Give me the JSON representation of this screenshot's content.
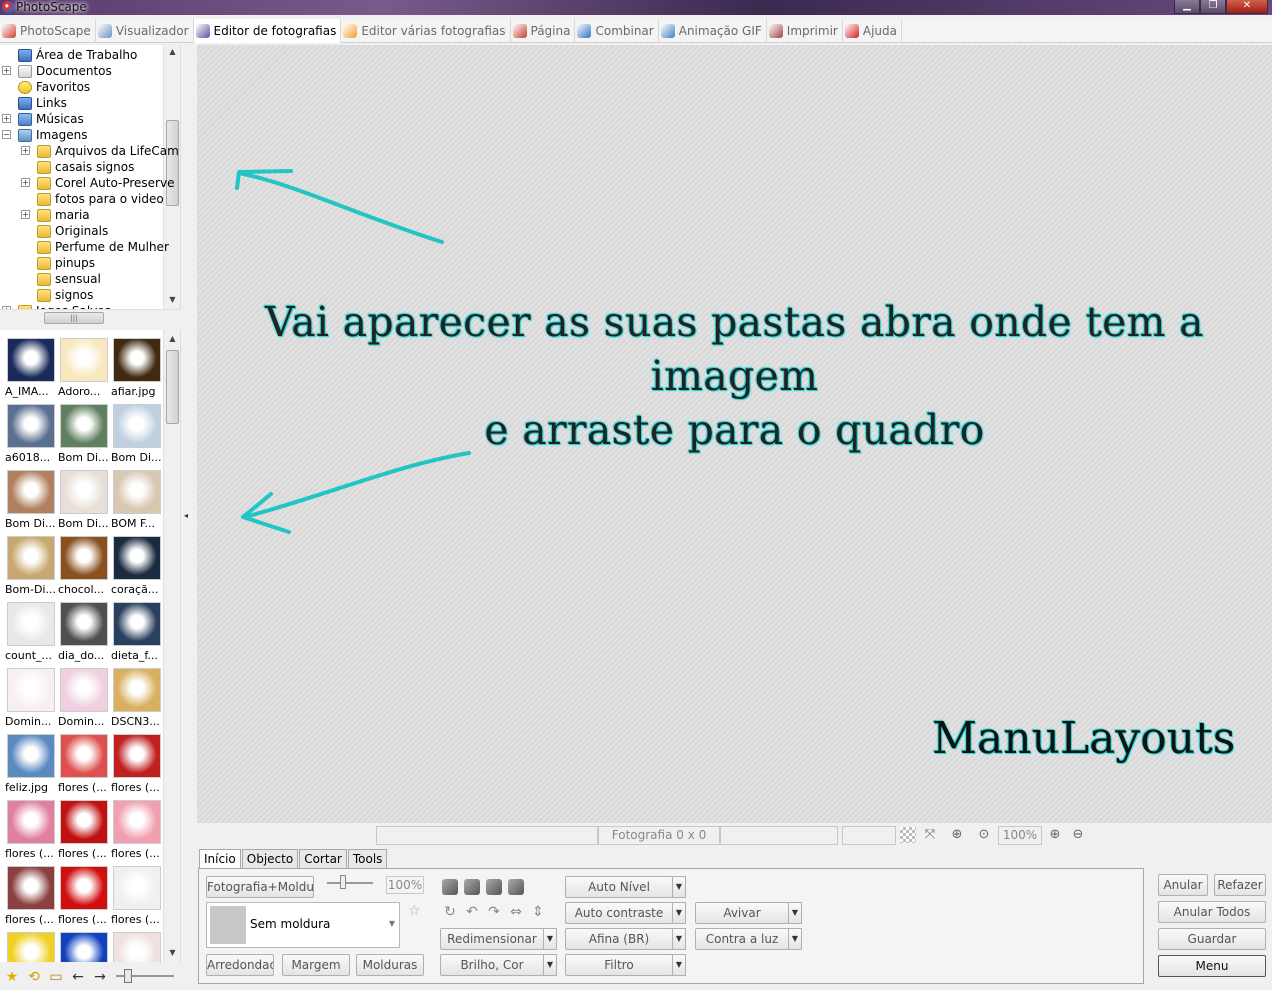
{
  "window": {
    "title": "PhotoScape",
    "min": "▁",
    "max": "❐",
    "close": "✕"
  },
  "tabs": [
    {
      "label": "PhotoScape",
      "color": "#d04030"
    },
    {
      "label": "Visualizador",
      "color": "#7090c0"
    },
    {
      "label": "Editor de fotografias",
      "color": "#6050a0",
      "active": true
    },
    {
      "label": "Editor várias fotografias",
      "color": "#f0a030"
    },
    {
      "label": "Página",
      "color": "#c04030"
    },
    {
      "label": "Combinar",
      "color": "#3070c0"
    },
    {
      "label": "Animação GIF",
      "color": "#4080c0"
    },
    {
      "label": "Imprimir",
      "color": "#a04040"
    },
    {
      "label": "Ajuda",
      "color": "#d02020"
    }
  ],
  "tree": {
    "items": [
      "Área de Trabalho",
      "Documentos",
      "Favoritos",
      "Links",
      "Músicas",
      "Imagens",
      "Arquivos da LifeCam",
      "casais signos",
      "Corel Auto-Preserve",
      "fotos para o video",
      "maria",
      "Originals",
      "Perfume de Mulher",
      "pinups",
      "sensual",
      "signos",
      "Jogos Salvos"
    ]
  },
  "thumbnails": [
    "A_IMA...",
    "Adoro...",
    "afiar.jpg",
    "a6018...",
    "Bom Di...",
    "Bom Di...",
    "Bom Di...",
    "Bom Di...",
    "BOM F...",
    "Bom-Di...",
    "chocol...",
    "coraçã...",
    "count_...",
    "dia_do...",
    "dieta_f...",
    "Domin...",
    "Domin...",
    "DSCN3...",
    "feliz.jpg",
    "flores (...",
    "flores (...",
    "flores (...",
    "flores (...",
    "flores (...",
    "flores (...",
    "flores (...",
    "flores (...",
    "",
    "",
    ""
  ],
  "thumb_colors": [
    "#1a2a5a",
    "#f8e8c0",
    "#402a10",
    "#5a7090",
    "#608060",
    "#c0d0e0",
    "#b08060",
    "#e8e0d8",
    "#d8c8b0",
    "#c8a870",
    "#8a5020",
    "#1a2a40",
    "#e8e8e8",
    "#505050",
    "#2a4060",
    "#f8f0f0",
    "#f0d0e0",
    "#d8b060",
    "#5a8ac0",
    "#e05050",
    "#c02020",
    "#e080a0",
    "#c01010",
    "#f0a0b0",
    "#8a4040",
    "#d01010",
    "#f0f0f0",
    "#f0d020",
    "#1040c0",
    "#f0e0e0"
  ],
  "canvas": {
    "line1": "Vai aparecer as suas pastas abra onde tem a imagem",
    "line2": "e arraste para o quadro",
    "signature": "ManuLayouts"
  },
  "status": {
    "photo": "Fotografia 0 x 0",
    "zoom": "100%"
  },
  "bottom_tabs": [
    "Início",
    "Objecto",
    "Cortar",
    "Tools"
  ],
  "panel": {
    "frame_button": "Fotografia+Moldura",
    "slider_value": "100%",
    "frame_name": "Sem moldura",
    "round": "Arredondado",
    "margin": "Margem",
    "frames": "Molduras",
    "auto_level": "Auto Nível",
    "auto_contrast": "Auto contraste",
    "sharpen": "Afina (BR)",
    "filter": "Filtro",
    "resize": "Redimensionar",
    "brightness": "Brilho, Cor",
    "vivid": "Avivar",
    "backlight": "Contra a luz"
  },
  "right_buttons": {
    "undo": "Anular",
    "redo": "Refazer",
    "undo_all": "Anular Todos",
    "save": "Guardar",
    "menu": "Menu"
  }
}
